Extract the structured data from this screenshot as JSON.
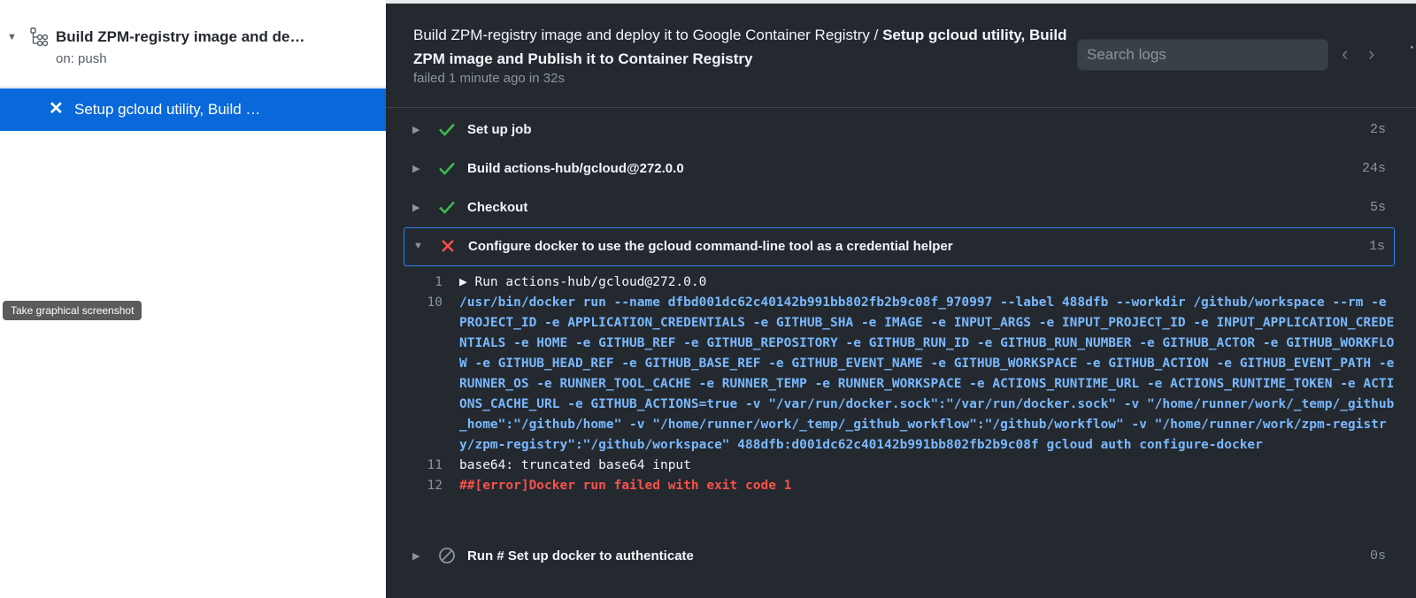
{
  "sidebar": {
    "workflow_title": "Build ZPM-registry image and de…",
    "workflow_trigger": "on: push",
    "job_label": "Setup gcloud utility, Build …"
  },
  "tooltip": "Take graphical screenshot",
  "header": {
    "breadcrumb_workflow": "Build ZPM-registry image and deploy it to Google Container Registry /",
    "breadcrumb_job": "Setup gcloud utility, Build ZPM image and Publish it to Container Registry",
    "status": "failed 1 minute ago in 32s",
    "search_placeholder": "Search logs"
  },
  "steps": [
    {
      "name": "Set up job",
      "duration": "2s",
      "status": "success"
    },
    {
      "name": "Build actions-hub/gcloud@272.0.0",
      "duration": "24s",
      "status": "success"
    },
    {
      "name": "Checkout",
      "duration": "5s",
      "status": "success"
    },
    {
      "name": "Configure docker to use the gcloud command-line tool as a credential helper",
      "duration": "1s",
      "status": "failure"
    },
    {
      "name": "Run # Set up docker to authenticate",
      "duration": "0s",
      "status": "skipped"
    }
  ],
  "log": [
    {
      "num": "1",
      "text": "▶ Run actions-hub/gcloud@272.0.0"
    },
    {
      "num": "10",
      "text": "/usr/bin/docker run --name dfbd001dc62c40142b991bb802fb2b9c08f_970997 --label 488dfb --workdir /github/workspace --rm -e PROJECT_ID -e APPLICATION_CREDENTIALS -e GITHUB_SHA -e IMAGE -e INPUT_ARGS -e INPUT_PROJECT_ID -e INPUT_APPLICATION_CREDENTIALS -e HOME -e GITHUB_REF -e GITHUB_REPOSITORY -e GITHUB_RUN_ID -e GITHUB_RUN_NUMBER -e GITHUB_ACTOR -e GITHUB_WORKFLOW -e GITHUB_HEAD_REF -e GITHUB_BASE_REF -e GITHUB_EVENT_NAME -e GITHUB_WORKSPACE -e GITHUB_ACTION -e GITHUB_EVENT_PATH -e RUNNER_OS -e RUNNER_TOOL_CACHE -e RUNNER_TEMP -e RUNNER_WORKSPACE -e ACTIONS_RUNTIME_URL -e ACTIONS_RUNTIME_TOKEN -e ACTIONS_CACHE_URL -e GITHUB_ACTIONS=true -v \"/var/run/docker.sock\":\"/var/run/docker.sock\" -v \"/home/runner/work/_temp/_github_home\":\"/github/home\" -v \"/home/runner/work/_temp/_github_workflow\":\"/github/workflow\" -v \"/home/runner/work/zpm-registry/zpm-registry\":\"/github/workspace\" 488dfb:d001dc62c40142b991bb802fb2b9c08f gcloud auth configure-docker"
    },
    {
      "num": "11",
      "text": "base64: truncated base64 input"
    },
    {
      "num": "12",
      "text": "##[error]Docker run failed with exit code 1"
    }
  ],
  "colors": {
    "success": "#3fb950",
    "failure": "#f85149",
    "accent": "#0969da"
  }
}
